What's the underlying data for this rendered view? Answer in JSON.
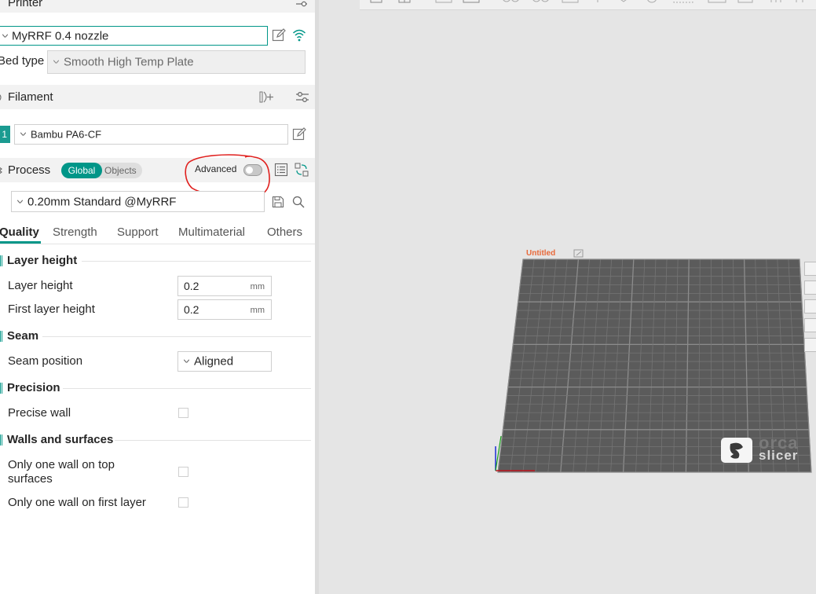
{
  "printer": {
    "section_title": "Printer",
    "preset": "MyRRF 0.4 nozzle",
    "bed_type_label": "Bed type",
    "bed_type_value": "Smooth High Temp Plate"
  },
  "filament": {
    "section_title": "Filament",
    "slot_number": "1",
    "preset": "Bambu PA6-CF"
  },
  "process": {
    "section_title": "Process",
    "toggle_global": "Global",
    "toggle_objects": "Objects",
    "advanced_label": "Advanced",
    "preset": "0.20mm Standard @MyRRF",
    "tabs": [
      "Quality",
      "Strength",
      "Support",
      "Multimaterial",
      "Others"
    ],
    "active_tab": "Quality"
  },
  "quality": {
    "layer_height_group": "Layer height",
    "layer_height_label": "Layer height",
    "layer_height_value": "0.2",
    "layer_height_unit": "mm",
    "first_layer_height_label": "First layer height",
    "first_layer_height_value": "0.2",
    "first_layer_height_unit": "mm",
    "seam_group": "Seam",
    "seam_position_label": "Seam position",
    "seam_position_value": "Aligned",
    "precision_group": "Precision",
    "precise_wall_label": "Precise wall",
    "precise_wall_checked": false,
    "walls_group": "Walls and surfaces",
    "one_wall_top_label": "Only one wall on top surfaces",
    "one_wall_top_checked": false,
    "one_wall_first_label": "Only one wall on first layer",
    "one_wall_first_checked": false
  },
  "plate": {
    "name": "Untitled",
    "logo_word_top": "orca",
    "logo_word_bottom": "slicer"
  },
  "colors": {
    "accent": "#009688",
    "annotation_red": "#e0201e",
    "plate_surface": "#5b5b5b",
    "plate_grid": "#7a7a7a",
    "plate_name": "#e8693a"
  }
}
